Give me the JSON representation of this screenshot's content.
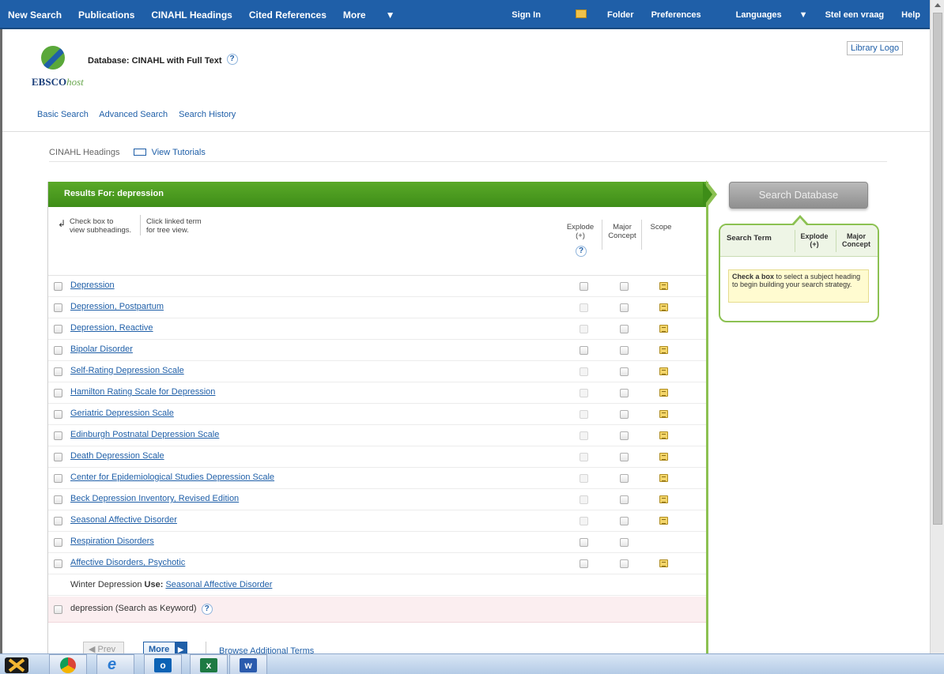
{
  "topnav": {
    "left": [
      "New Search",
      "Publications",
      "CINAHL Headings",
      "Cited References",
      "More"
    ],
    "right": {
      "sign_in": "Sign In",
      "folder": "Folder",
      "preferences": "Preferences",
      "languages": "Languages",
      "ask": "Stel een vraag",
      "help": "Help"
    }
  },
  "header": {
    "database_label": "Database: CINAHL with Full Text",
    "logo_main": "EBSCO",
    "logo_sub": "host",
    "library_logo": "Library Logo",
    "help_glyph": "?"
  },
  "subnav": [
    "Basic Search",
    "Advanced Search",
    "Search History"
  ],
  "breadcrumb": {
    "current": "CINAHL Headings",
    "tutorials": "View Tutorials"
  },
  "results": {
    "title": "Results For: depression",
    "hint_checkbox": [
      "Check box to",
      "view subheadings."
    ],
    "hint_link": [
      "Click linked term",
      "for tree view."
    ],
    "col_explode": [
      "Explode",
      "(+)"
    ],
    "col_major": [
      "Major",
      "Concept"
    ],
    "col_scope": "Scope",
    "rows": [
      {
        "term": "Depression",
        "explode_enabled": true,
        "scope": true
      },
      {
        "term": "Depression, Postpartum",
        "explode_enabled": false,
        "scope": true
      },
      {
        "term": "Depression, Reactive",
        "explode_enabled": false,
        "scope": true
      },
      {
        "term": "Bipolar Disorder",
        "explode_enabled": true,
        "scope": true
      },
      {
        "term": "Self-Rating Depression Scale",
        "explode_enabled": false,
        "scope": true
      },
      {
        "term": "Hamilton Rating Scale for Depression",
        "explode_enabled": false,
        "scope": true
      },
      {
        "term": "Geriatric Depression Scale",
        "explode_enabled": false,
        "scope": true
      },
      {
        "term": "Edinburgh Postnatal Depression Scale",
        "explode_enabled": false,
        "scope": true
      },
      {
        "term": "Death Depression Scale",
        "explode_enabled": false,
        "scope": true
      },
      {
        "term": "Center for Epidemiological Studies Depression Scale",
        "explode_enabled": false,
        "scope": true
      },
      {
        "term": "Beck Depression Inventory, Revised Edition",
        "explode_enabled": false,
        "scope": true
      },
      {
        "term": "Seasonal Affective Disorder",
        "explode_enabled": false,
        "scope": true
      },
      {
        "term": "Respiration Disorders",
        "explode_enabled": true,
        "scope": false
      },
      {
        "term": "Affective Disorders, Psychotic",
        "explode_enabled": true,
        "scope": true
      }
    ],
    "use_row": {
      "term": "Winter Depression",
      "use_label": "Use:",
      "target": "Seasonal Affective Disorder"
    },
    "keyword_row": "depression (Search as Keyword)",
    "pager": {
      "prev": "Prev",
      "more": "More",
      "browse": "Browse Additional Terms"
    }
  },
  "sidebar": {
    "search_button": "Search Database",
    "col_term": "Search Term",
    "col_explode": [
      "Explode",
      "(+)"
    ],
    "col_major": [
      "Major",
      "Concept"
    ],
    "note_bold": "Check a box",
    "note_rest": " to select a subject heading to begin building your search strategy."
  },
  "taskbar": {
    "apps": [
      "xmind-icon",
      "chrome-icon",
      "internet-explorer-icon",
      "outlook-icon",
      "excel-icon",
      "word-icon"
    ]
  }
}
